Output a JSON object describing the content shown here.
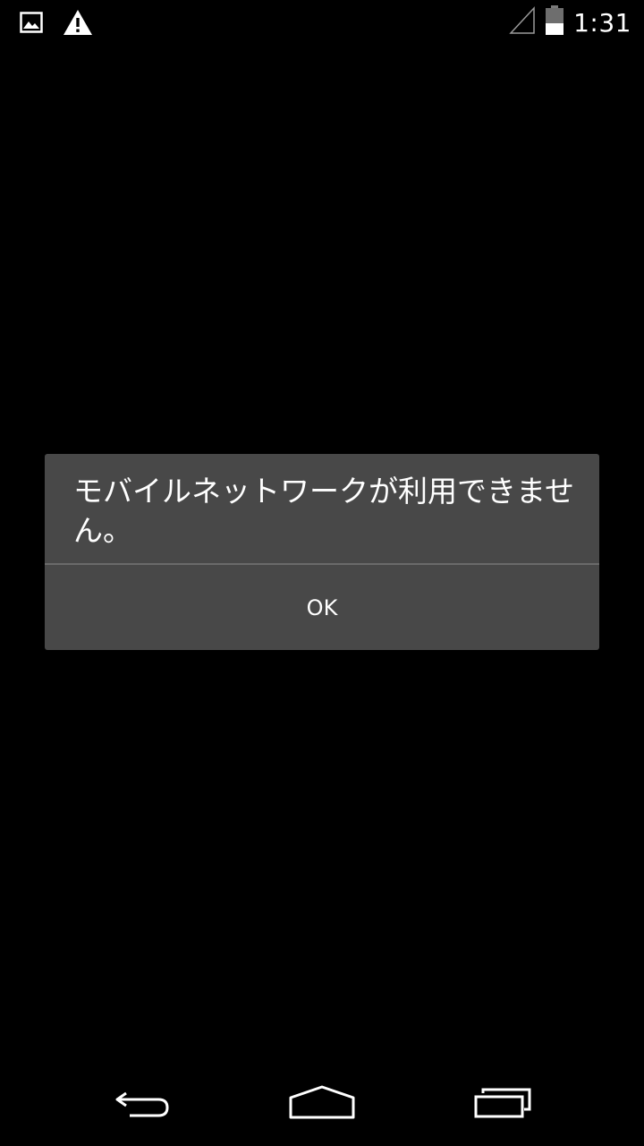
{
  "status_bar": {
    "time": "1:31",
    "icons": [
      "image-notification-icon",
      "warning-icon",
      "signal-icon",
      "battery-icon"
    ]
  },
  "dialog": {
    "message": "モバイルネットワークが利用できません。",
    "ok_label": "OK"
  },
  "nav_bar": {
    "icons": [
      "back-icon",
      "home-icon",
      "recents-icon"
    ]
  },
  "colors": {
    "background": "#000000",
    "dialog_bg": "#484848",
    "divider": "#6a6a6a",
    "text": "#ffffff"
  }
}
